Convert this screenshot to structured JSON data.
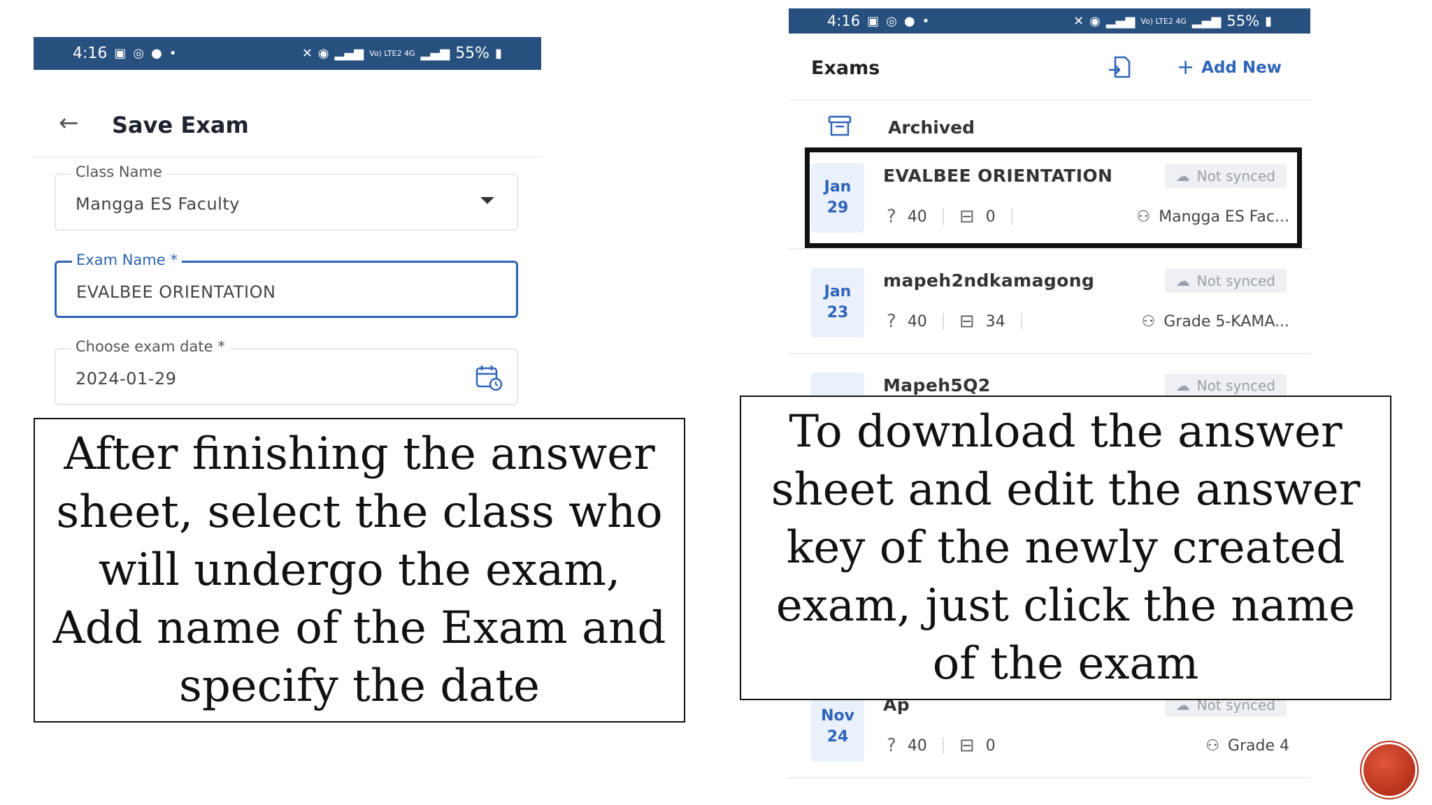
{
  "left_screen": {
    "status": {
      "time": "4:16",
      "battery": "55%",
      "network": "Vo) LTE2 4G"
    },
    "title": "Save Exam",
    "fields": {
      "class_name": {
        "label": "Class Name",
        "value": "Mangga ES Faculty"
      },
      "exam_name": {
        "label": "Exam Name *",
        "value": "EVALBEE ORIENTATION"
      },
      "exam_date": {
        "label": "Choose exam date *",
        "value": "2024-01-29"
      }
    }
  },
  "right_screen": {
    "status": {
      "time": "4:16",
      "battery": "55%",
      "network": "Vo) LTE2 4G"
    },
    "title": "Exams",
    "add_new": "Add New",
    "archived": "Archived",
    "exams": [
      {
        "month": "Jan",
        "day": "29",
        "name": "EVALBEE ORIENTATION",
        "sync": "Not synced",
        "questions": "40",
        "sheets": "0",
        "class": "Mangga ES Fac..."
      },
      {
        "month": "Jan",
        "day": "23",
        "name": "mapeh2ndkamagong",
        "sync": "Not synced",
        "questions": "40",
        "sheets": "34",
        "class": "Grade 5-KAMA..."
      },
      {
        "month": "",
        "day": "",
        "name": "Mapeh5Q2",
        "sync": "Not synced",
        "questions": "",
        "sheets": "",
        "class": ""
      },
      {
        "month": "Nov",
        "day": "24",
        "name": "Ap",
        "sync": "Not synced",
        "questions": "40",
        "sheets": "0",
        "class": "Grade 4"
      }
    ]
  },
  "notes": {
    "left": "After finishing the answer sheet, select the class who will undergo the exam, Add name of the Exam and specify the date",
    "right": "To download the answer sheet and edit the answer key of the newly created exam, just click the name of the exam"
  },
  "colors": {
    "status_bar": "#27507f",
    "accent": "#2f64b9",
    "highlight_border": "#111111",
    "corner_button": "#c0391f"
  }
}
